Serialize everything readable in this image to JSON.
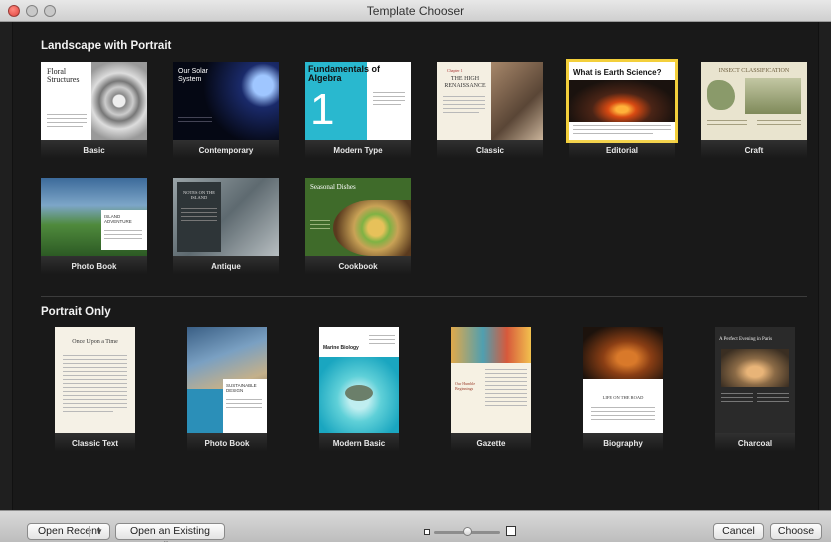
{
  "window": {
    "title": "Template Chooser"
  },
  "sections": {
    "landscape": {
      "title": "Landscape with Portrait"
    },
    "portrait": {
      "title": "Portrait Only"
    }
  },
  "landscape_templates": [
    {
      "label": "Basic",
      "preview_heading": "Floral Structures"
    },
    {
      "label": "Contemporary",
      "preview_heading": "Our Solar System"
    },
    {
      "label": "Modern Type",
      "preview_heading": "Fundamentals of Algebra",
      "preview_number": "1"
    },
    {
      "label": "Classic",
      "preview_heading": "THE HIGH RENAISSANCE",
      "preview_kicker": "Chapter 1"
    },
    {
      "label": "Editorial",
      "preview_heading": "What is Earth Science?",
      "selected": true
    },
    {
      "label": "Craft",
      "preview_heading": "INSECT CLASSIFICATION"
    },
    {
      "label": "Photo Book",
      "preview_heading": "ISLAND ADVENTURE"
    },
    {
      "label": "Antique",
      "preview_heading": "NOTES ON THE ISLAND"
    },
    {
      "label": "Cookbook",
      "preview_heading": "Seasonal Dishes"
    }
  ],
  "portrait_templates": [
    {
      "label": "Classic Text",
      "preview_heading": "Once Upon a Time"
    },
    {
      "label": "Photo Book",
      "preview_heading": "SUSTAINABLE DESIGN"
    },
    {
      "label": "Modern Basic",
      "preview_heading": "Marine Biology"
    },
    {
      "label": "Gazette",
      "preview_heading": "Our Humble Beginnings"
    },
    {
      "label": "Biography",
      "preview_heading": "LIFE ON THE ROAD"
    },
    {
      "label": "Charcoal",
      "preview_heading": "A Perfect Evening in Paris"
    }
  ],
  "bottom_bar": {
    "open_recent": "Open Recent",
    "open_existing": "Open an Existing File...",
    "cancel": "Cancel",
    "choose": "Choose",
    "zoom_level": 0.5
  },
  "colors": {
    "selection_outline": "#f3cf3b",
    "background": "#191919"
  },
  "icons": {
    "dropdown": "chevron-down-icon",
    "zoom_small": "small-thumbnail-icon",
    "zoom_large": "large-thumbnail-icon"
  }
}
